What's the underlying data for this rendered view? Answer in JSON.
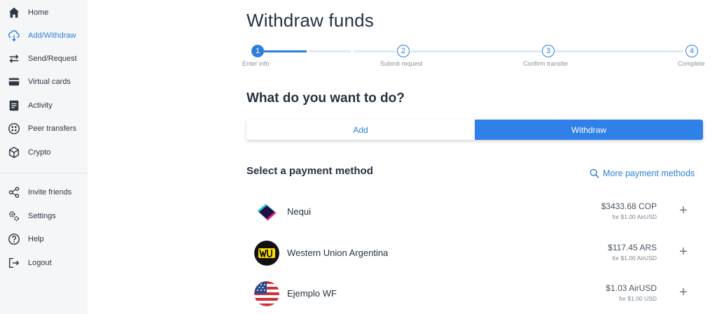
{
  "sidebar": {
    "items": [
      {
        "label": "Home",
        "icon": "home-icon"
      },
      {
        "label": "Add/Withdraw",
        "icon": "cloud-transfer-icon",
        "active": true
      },
      {
        "label": "Send/Request",
        "icon": "swap-arrows-icon"
      },
      {
        "label": "Virtual cards",
        "icon": "card-icon"
      },
      {
        "label": "Activity",
        "icon": "list-icon"
      },
      {
        "label": "Peer transfers",
        "icon": "peer-icon"
      },
      {
        "label": "Crypto",
        "icon": "cube-icon"
      },
      {
        "label": "Invite friends",
        "icon": "share-icon"
      },
      {
        "label": "Settings",
        "icon": "gear-icon"
      },
      {
        "label": "Help",
        "icon": "help-icon"
      },
      {
        "label": "Logout",
        "icon": "logout-icon"
      }
    ]
  },
  "main": {
    "title": "Withdraw funds",
    "steps": [
      {
        "number": "1",
        "label": "Enter info"
      },
      {
        "number": "2",
        "label": "Submit request"
      },
      {
        "number": "3",
        "label": "Confirm transfer"
      },
      {
        "number": "4",
        "label": "Complete"
      }
    ],
    "question": "What do you want to do?",
    "toggle": {
      "add": "Add",
      "withdraw": "Withdraw",
      "selected": "Withdraw"
    },
    "methods_title": "Select a payment method",
    "more_methods": "More payment methods",
    "methods": [
      {
        "name": "Nequi",
        "amount": "$3433.68 COP",
        "rate": "for $1.00 AirUSD"
      },
      {
        "name": "Western Union Argentina",
        "amount": "$117.45 ARS",
        "rate": "for $1.00 AirUSD"
      },
      {
        "name": "Ejemplo WF",
        "amount": "$1.03 AirUSD",
        "rate": "for $1.00 USD"
      }
    ],
    "plus": "+"
  },
  "colors": {
    "accent": "#2e7fd8",
    "sidebar_bg": "#f5f6f8",
    "text": "#26323f"
  }
}
